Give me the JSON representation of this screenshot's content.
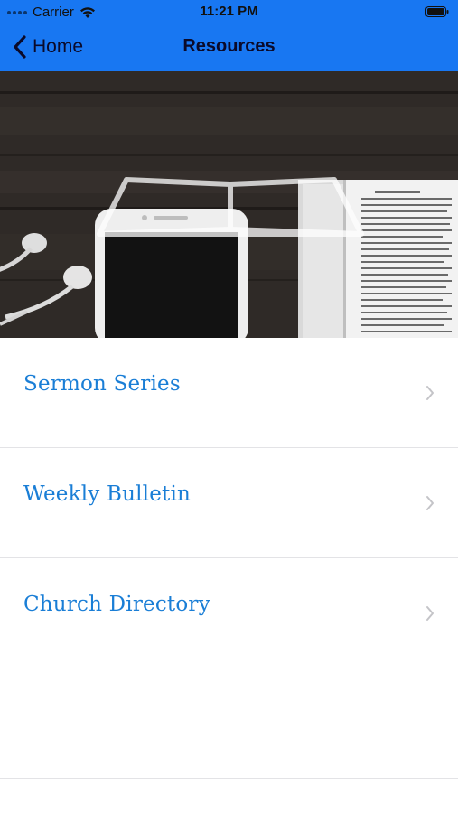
{
  "status_bar": {
    "carrier": "Carrier",
    "time": "11:21 PM",
    "background_color": "#1877f2"
  },
  "nav_bar": {
    "back_label": "Home",
    "title": "Resources",
    "background_color": "#1877f2",
    "back_icon": "chevron-left-icon"
  },
  "hero": {
    "image_description": "open bible, smartphone and earbuds on dark wood",
    "logo_icon": "open-book-logo-icon"
  },
  "list": {
    "items": [
      {
        "label": "Sermon Series",
        "icon": "chevron-right-icon"
      },
      {
        "label": "Weekly Bulletin",
        "icon": "chevron-right-icon"
      },
      {
        "label": "Church Directory",
        "icon": "chevron-right-icon"
      }
    ],
    "text_color": "#1a7ed6",
    "chevron_color": "#c4c4c8"
  }
}
